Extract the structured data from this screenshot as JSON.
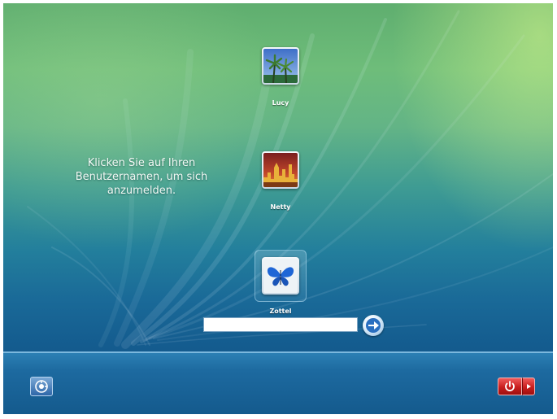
{
  "login": {
    "instruction": "Klicken Sie auf Ihren Benutzernamen, um sich anzumelden.",
    "users": [
      {
        "name": "Lucy",
        "picture": "palm-trees"
      },
      {
        "name": "Netty",
        "picture": "city-skyline"
      },
      {
        "name": "Zottel",
        "picture": "butterfly"
      }
    ],
    "selected_user": "Zottel",
    "password_field": {
      "value": "",
      "placeholder": ""
    },
    "submit_icon": "arrow-right-icon"
  },
  "footer": {
    "ease_of_access_icon": "ease-of-access-icon",
    "power_icon": "power-icon",
    "power_menu_icon": "triangle-right-icon"
  },
  "colors": {
    "background_top": "#6ebd7a",
    "background_bottom": "#114f80",
    "power_button": "#c81e1e"
  }
}
